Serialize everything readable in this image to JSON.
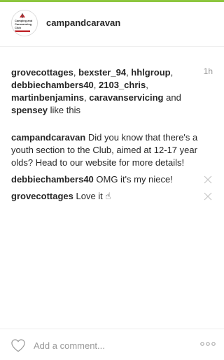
{
  "post": {
    "username": "campandcaravan",
    "timestamp": "1h",
    "avatar_icon": "club-logo-icon",
    "avatar_text": [
      "Camping and",
      "Caravanning",
      "Club"
    ],
    "accent_color": "#8dc63f",
    "likes": {
      "users": [
        "grovecottages",
        "bexster_94",
        "hhlgroup",
        "debbiechambers40",
        "2103_chris",
        "martinbenjamins",
        "caravanservicing",
        "spensey"
      ],
      "sep": ", ",
      "and_text": " and ",
      "suffix": " like this"
    },
    "caption": {
      "author": "campandcaravan",
      "text": " Did you know that there's a youth section to the Club, aimed at 12-17 year olds? Head to our website for more details!"
    },
    "comments": [
      {
        "author": "debbiechambers40",
        "text": " OMG it's my niece!"
      },
      {
        "author": "grovecottages",
        "text": " Love it ",
        "emoji": "☝"
      }
    ]
  },
  "footer": {
    "comment_placeholder": "Add a comment...",
    "like_icon": "heart-icon",
    "more_icon": "more-options-icon"
  }
}
